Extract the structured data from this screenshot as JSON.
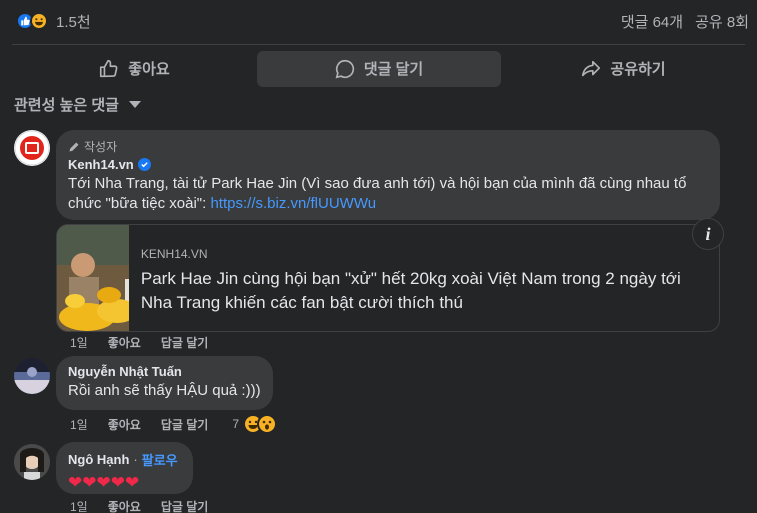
{
  "stats": {
    "reaction_count": "1.5천",
    "comments": "댓글 64개",
    "shares": "공유 8회"
  },
  "actions": {
    "like": "좋아요",
    "comment": "댓글 달기",
    "share": "공유하기"
  },
  "sort": {
    "label": "관련성 높은 댓글"
  },
  "comments": [
    {
      "badge": "작성자",
      "author": "Kenh14.vn",
      "text": "Tới Nha Trang, tài tử Park Hae Jin (Vì sao đưa anh tới) và hội bạn của mình đã cùng nhau tổ chức \"bữa tiệc xoài\": ",
      "link": "https://s.biz.vn/flUUWWu",
      "preview": {
        "domain": "KENH14.VN",
        "title": "Park Hae Jin cùng hội bạn \"xử\" hết 20kg xoài Việt Nam trong 2 ngày tới Nha Trang khiến các fan bật cười thích thú"
      },
      "time": "1일",
      "like": "좋아요",
      "reply": "답글 달기"
    },
    {
      "author": "Nguyễn Nhật Tuấn",
      "text": "Rồi anh sẽ thấy HẬU quả :)))",
      "time": "1일",
      "like": "좋아요",
      "reply": "답글 달기",
      "reaction_count": "7"
    },
    {
      "author": "Ngô Hạnh",
      "separator": "·",
      "follow": "팔로우",
      "hearts": "❤❤❤❤❤",
      "time": "1일",
      "like": "좋아요",
      "reply": "답글 달기"
    }
  ],
  "colors": {
    "background": "#242526",
    "bubble": "#3a3b3c",
    "link": "#4599ff",
    "like_blue": "#1877f2",
    "heart_red": "#f02849"
  }
}
